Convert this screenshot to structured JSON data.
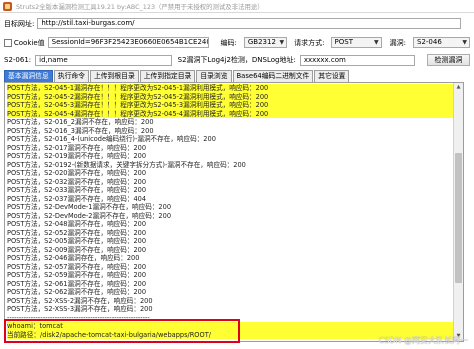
{
  "window": {
    "title": "Struts2全版本漏洞检测工具19.21 by:ABC_123（严禁用于未授权的测试及非法用途）"
  },
  "target": {
    "label": "目标网址:",
    "url": "http://stil.taxi-burgas.com/"
  },
  "options": {
    "cookie_label": "Cookie值",
    "session_value": "SessionId=96F3F25423E0660E0654B1CE240C3C36",
    "encoding_label": "编码:",
    "encoding_value": "GB2312",
    "request_method_label": "请求方式:",
    "request_method_value": "POST",
    "vuln_label": "漏洞:",
    "vuln_value": "S2-046"
  },
  "s2_061": {
    "label": "S2-061:",
    "value": "id,name",
    "dnslog_label": "S2漏洞下Log4j2检测，DNSLog地址:",
    "dnslog_value": "xxxxxx.com",
    "detect_button": "检测漏洞"
  },
  "tabs": [
    "基本漏洞信息",
    "执行命令",
    "上传到根目录",
    "上传到指定目录",
    "目录浏览",
    "Base64编码二进制文件",
    "其它设置"
  ],
  "output_lines": [
    {
      "text": "POST方法，S2-045-1漏洞存在！！！程序更改为S2-045-1漏洞利用模式，响应码：200",
      "hl": true
    },
    {
      "text": "POST方法，S2-045-2漏洞存在！！！程序更改为S2-045-2漏洞利用模式，响应码：200",
      "hl": true
    },
    {
      "text": "POST方法，S2-045-3漏洞存在！！！程序更改为S2-045-3漏洞利用模式，响应码：200",
      "hl": true
    },
    {
      "text": "POST方法，S2-045-4漏洞存在！！！程序更改为S2-045-4漏洞利用模式，响应码：200",
      "hl": true
    },
    {
      "text": "POST方法，S2-016_2漏洞不存在，响应码：200",
      "hl": false
    },
    {
      "text": "POST方法，S2-016_3漏洞不存在，响应码：200",
      "hl": false
    },
    {
      "text": "POST方法，S2-016_4-(unicode编码绕行)-漏洞不存在，响应码：200",
      "hl": false
    },
    {
      "text": "POST方法，S2-017漏洞不存在，响应码：200",
      "hl": false
    },
    {
      "text": "POST方法，S2-019漏洞不存在，响应码：200",
      "hl": false
    },
    {
      "text": "POST方法，S2-0192-(新数据请求，关键字拆分方式)-漏洞不存在，响应码：200",
      "hl": false
    },
    {
      "text": "POST方法，S2-020漏洞不存在，响应码：200",
      "hl": false
    },
    {
      "text": "POST方法，S2-032漏洞不存在，响应码：200",
      "hl": false
    },
    {
      "text": "POST方法，S2-033漏洞不存在，响应码：200",
      "hl": false
    },
    {
      "text": "POST方法，S2-037漏洞不存在，响应码：404",
      "hl": false
    },
    {
      "text": "POST方法，S2-DevMode-1漏洞不存在，响应码：200",
      "hl": false
    },
    {
      "text": "POST方法，S2-DevMode-2漏洞不存在，响应码：200",
      "hl": false
    },
    {
      "text": "POST方法，S2-048漏洞不存在，响应码：200",
      "hl": false
    },
    {
      "text": "POST方法，S2-052漏洞不存在，响应码：200",
      "hl": false
    },
    {
      "text": "POST方法，S2-005漏洞不存在，响应码：200",
      "hl": false
    },
    {
      "text": "POST方法，S2-009漏洞不存在，响应码：200",
      "hl": false
    },
    {
      "text": "POST方法，S2-046漏洞存在，响应码：200",
      "hl": false
    },
    {
      "text": "POST方法，S2-057漏洞不存在，响应码：200",
      "hl": false
    },
    {
      "text": "POST方法，S2-059漏洞不存在，响应码：200",
      "hl": false
    },
    {
      "text": "POST方法，S2-061漏洞不存在，响应码：200",
      "hl": false
    },
    {
      "text": "POST方法，S2-062漏洞不存在，响应码：200",
      "hl": false
    },
    {
      "text": "POST方法，S2-XSS-2漏洞不存在，响应码：200",
      "hl": false
    },
    {
      "text": "POST方法，S2-XSS-3漏洞不存在，响应码：200",
      "hl": false
    },
    {
      "text": "------------------------------------------------------------",
      "hl": false
    },
    {
      "text": "whoami：tomcat",
      "hl": true
    },
    {
      "text": "当前路径：/disk2/apache-tomcat-taxi-bulgaria/webapps/ROOT/",
      "hl": true
    }
  ],
  "watermark": "CSDN @网安大队长阿一"
}
